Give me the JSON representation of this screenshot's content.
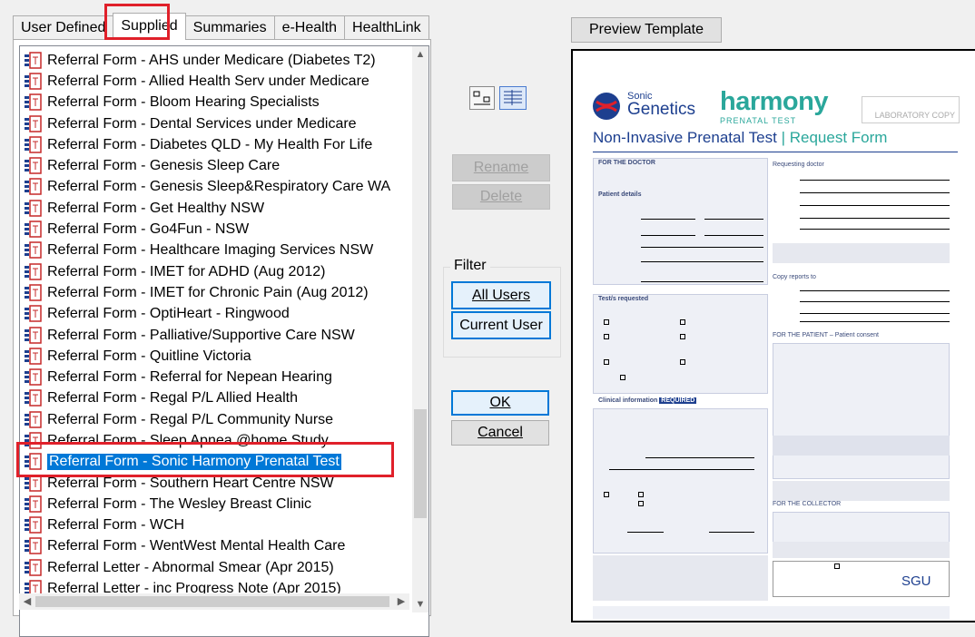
{
  "tabs": [
    {
      "label": "User Defined",
      "active": false
    },
    {
      "label": "Supplied",
      "active": true
    },
    {
      "label": "Summaries",
      "active": false
    },
    {
      "label": "e-Health",
      "active": false
    },
    {
      "label": "HealthLink",
      "active": false
    }
  ],
  "list": {
    "items": [
      "Referral Form - AHS under Medicare (Diabetes T2)",
      "Referral Form - Allied Health Serv under Medicare",
      "Referral Form - Bloom Hearing Specialists",
      "Referral Form - Dental Services under Medicare",
      "Referral Form - Diabetes QLD - My Health For Life",
      "Referral Form - Genesis Sleep Care",
      "Referral Form - Genesis Sleep&Respiratory Care WA",
      "Referral Form - Get Healthy NSW",
      "Referral Form - Go4Fun - NSW",
      "Referral Form - Healthcare Imaging Services NSW",
      "Referral Form - IMET for ADHD (Aug 2012)",
      "Referral Form - IMET for Chronic Pain (Aug 2012)",
      "Referral Form - OptiHeart - Ringwood",
      "Referral Form - Palliative/Supportive Care NSW",
      "Referral Form - Quitline Victoria",
      "Referral Form - Referral for Nepean Hearing",
      "Referral Form - Regal P/L Allied Health",
      "Referral Form - Regal P/L Community Nurse",
      "Referral Form - Sleep Apnea @home Study",
      "Referral Form - Sonic Harmony Prenatal Test",
      "Referral Form - Southern Heart Centre NSW",
      "Referral Form - The Wesley Breast Clinic",
      "Referral Form - WCH",
      "Referral Form - WentWest Mental Health Care",
      "Referral Letter - Abnormal Smear (Apr 2015)",
      "Referral Letter - inc Progress Note (Apr 2015)"
    ],
    "selected_index": 19
  },
  "buttons": {
    "rename": "Rename",
    "delete": "Delete",
    "filter_title": "Filter",
    "all_users": "All Users",
    "current_user": "Current User",
    "ok": "OK",
    "cancel": "Cancel",
    "preview_template": "Preview Template"
  },
  "preview": {
    "brand_sonic": "Sonic",
    "brand_genetics": "Genetics",
    "brand_harmony": "harmony",
    "brand_prenatal": "PRENATAL TEST",
    "lab_copy": "LABORATORY COPY",
    "title_main": "Non-Invasive Prenatal Test",
    "title_sep": "|",
    "title_sub": "Request Form",
    "for_doctor": "FOR THE DOCTOR",
    "requesting_doctor": "Requesting doctor",
    "patient_details": "Patient details",
    "copy_reports": "Copy reports to",
    "tests_requested": "Test/s requested",
    "for_patient": "FOR THE PATIENT – Patient consent",
    "clinical_info": "Clinical information",
    "required": "REQUIRED",
    "for_collector": "FOR THE COLLECTOR",
    "sgu": "SGU"
  },
  "colors": {
    "selection": "#0078d7",
    "highlight": "#e0202a",
    "harmony_green": "#2aa79b",
    "sonic_blue": "#1d3f8f"
  }
}
